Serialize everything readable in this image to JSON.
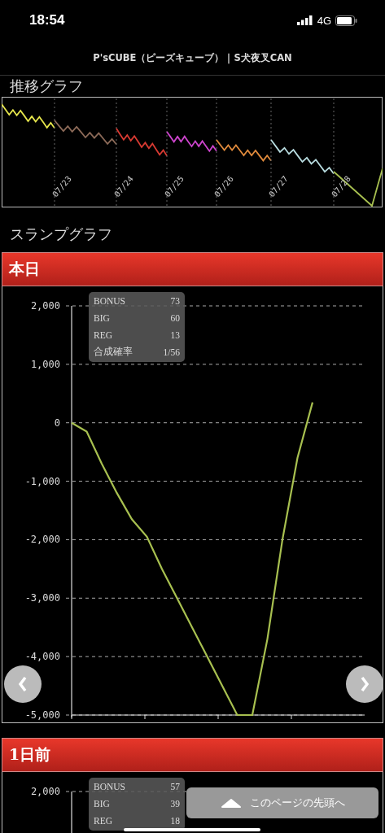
{
  "status_bar": {
    "time": "18:54",
    "network": "4G"
  },
  "header": {
    "title": "P'sCUBE（ピーズキューブ）｜S犬夜叉CAN"
  },
  "trend_graph": {
    "heading": "推移グラフ",
    "segments": [
      {
        "color": "#e6e64c"
      },
      {
        "label": "07/23",
        "color": "#8c6a58"
      },
      {
        "label": "07/24",
        "color": "#d83a32"
      },
      {
        "label": "07/25",
        "color": "#cc44cc"
      },
      {
        "label": "07/26",
        "color": "#e08a3c"
      },
      {
        "label": "07/27",
        "color": "#b8dce0"
      },
      {
        "label": "07/28",
        "color": "#a8c050"
      }
    ]
  },
  "slump_heading": "スランプグラフ",
  "days": [
    {
      "title": "本日",
      "tooltip": [
        {
          "label": "BONUS",
          "value": "73"
        },
        {
          "label": "BIG",
          "value": "60"
        },
        {
          "label": "REG",
          "value": "13"
        },
        {
          "label": "合成確率",
          "value": "1/56"
        }
      ],
      "chart_data": {
        "type": "line",
        "grid": true,
        "ylim": [
          -5000,
          2000
        ],
        "yticks": [
          {
            "value": 2000,
            "label": "2,000"
          },
          {
            "value": 1000,
            "label": "1,000"
          },
          {
            "value": 0,
            "label": "0"
          },
          {
            "value": -1000,
            "label": "-1,000"
          },
          {
            "value": -2000,
            "label": "-2,000"
          },
          {
            "value": -3000,
            "label": "-3,000"
          },
          {
            "value": -4000,
            "label": "-4,000"
          },
          {
            "value": -5000,
            "label": "-5,000"
          }
        ],
        "series": [
          {
            "color": "#a8c050",
            "values": [
              0,
              -150,
              -700,
              -1200,
              -1650,
              -1950,
              -2500,
              -3000,
              -3500,
              -4000,
              -4500,
              -5000,
              -5000,
              -3700,
              -2000,
              -600,
              350
            ]
          }
        ]
      }
    },
    {
      "title": "1日前",
      "tooltip": [
        {
          "label": "BONUS",
          "value": "57"
        },
        {
          "label": "BIG",
          "value": "39"
        },
        {
          "label": "REG",
          "value": "18"
        }
      ],
      "y_ticks": [
        "2,000"
      ]
    }
  ],
  "back_to_top": {
    "label": "このページの先頭へ"
  }
}
